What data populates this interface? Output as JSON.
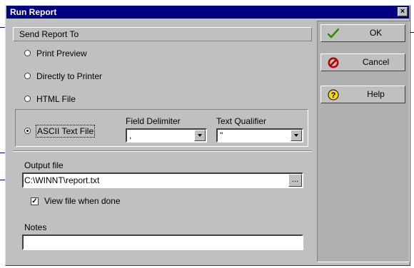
{
  "window": {
    "title": "Run Report",
    "close_glyph": "×"
  },
  "send_section": {
    "title": "Send Report To",
    "options": [
      {
        "label": "Print Preview",
        "selected": false
      },
      {
        "label": "Directly to Printer",
        "selected": false
      },
      {
        "label": "HTML File",
        "selected": false
      },
      {
        "label": "ASCII Text File",
        "selected": true
      }
    ],
    "field_delimiter": {
      "label": "Field Delimiter",
      "value": ","
    },
    "text_qualifier": {
      "label": "Text Qualifier",
      "value": "\""
    }
  },
  "output": {
    "label": "Output file",
    "value": "C:\\WINNT\\report.txt",
    "browse_label": "...",
    "view_checkbox": {
      "label": "View file when done",
      "checked": true,
      "glyph": "✓"
    }
  },
  "notes": {
    "label": "Notes",
    "value": ""
  },
  "buttons": {
    "ok": {
      "label": "OK",
      "icon": "checkmark-icon"
    },
    "cancel": {
      "label": "Cancel",
      "icon": "no-symbol-icon"
    },
    "help": {
      "label": "Help",
      "icon": "question-icon"
    }
  },
  "colors": {
    "titlebar": "#000080",
    "face": "#c0c0c0",
    "ok_icon": "#2e8b00",
    "cancel_icon": "#c00000",
    "help_icon": "#ffd700"
  }
}
